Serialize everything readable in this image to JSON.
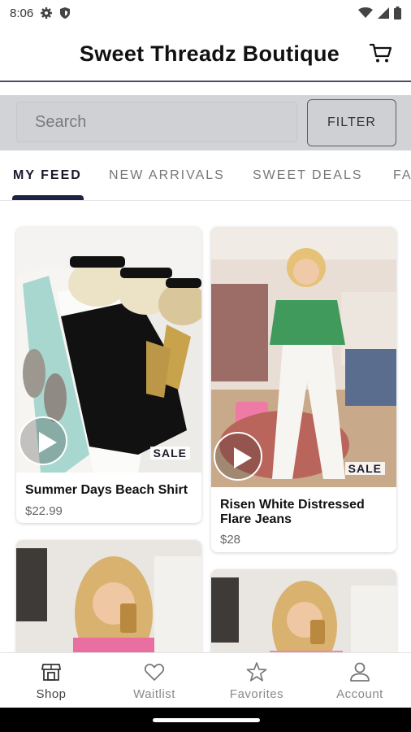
{
  "status_bar": {
    "time": "8:06",
    "icons": [
      "gear-icon",
      "shield-icon",
      "wifi-icon",
      "signal-icon",
      "battery-icon"
    ]
  },
  "header": {
    "title": "Sweet Threadz Boutique",
    "cart_icon": "cart-icon"
  },
  "search": {
    "placeholder": "Search",
    "value": "",
    "filter_label": "FILTER"
  },
  "tabs": [
    {
      "label": "MY FEED",
      "active": true
    },
    {
      "label": "NEW ARRIVALS",
      "active": false
    },
    {
      "label": "SWEET DEALS",
      "active": false
    },
    {
      "label": "FA",
      "active": false
    }
  ],
  "products": [
    {
      "title": "Summer Days Beach Shirt",
      "price": "$22.99",
      "badge": "SALE",
      "has_video": true
    },
    {
      "title": "Risen White Distressed Flare Jeans",
      "price": "$28",
      "badge": "SALE",
      "has_video": true
    },
    {
      "title": "",
      "price": "",
      "badge": "",
      "has_video": false
    },
    {
      "title": "",
      "price": "",
      "badge": "",
      "has_video": false
    }
  ],
  "bottom_nav": [
    {
      "label": "Shop",
      "icon": "shop-icon",
      "active": true
    },
    {
      "label": "Waitlist",
      "icon": "heart-icon",
      "active": false
    },
    {
      "label": "Favorites",
      "icon": "star-icon",
      "active": false
    },
    {
      "label": "Account",
      "icon": "person-icon",
      "active": false
    }
  ],
  "colors": {
    "accent": "#1d2340",
    "search_band": "#d2d3d6",
    "header_rule": "#4a4f63"
  }
}
